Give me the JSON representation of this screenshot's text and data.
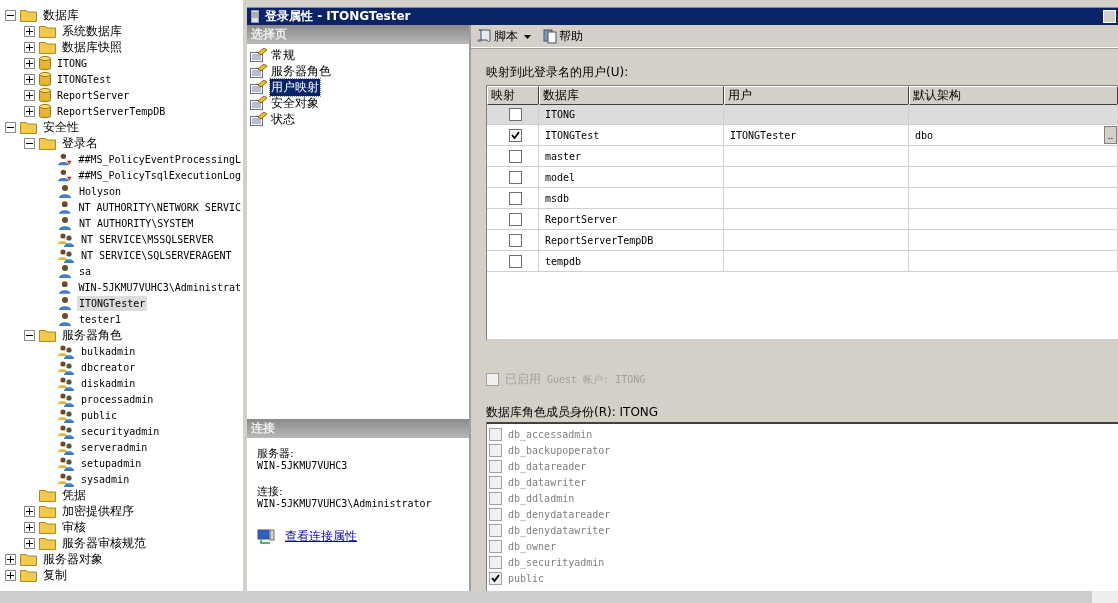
{
  "tree": [
    {
      "label": "数据库",
      "kind": "folder",
      "expanded": true,
      "selected": false,
      "children": [
        {
          "label": "系统数据库",
          "kind": "folder",
          "expanded": false,
          "selected": false
        },
        {
          "label": "数据库快照",
          "kind": "folder",
          "expanded": false,
          "selected": false
        },
        {
          "label": "ITONG",
          "kind": "database",
          "expanded": false,
          "selected": false
        },
        {
          "label": "ITONGTest",
          "kind": "database",
          "expanded": false,
          "selected": false
        },
        {
          "label": "ReportServer",
          "kind": "database",
          "expanded": false,
          "selected": false
        },
        {
          "label": "ReportServerTempDB",
          "kind": "database",
          "expanded": false,
          "selected": false
        }
      ]
    },
    {
      "label": "安全性",
      "kind": "folder",
      "expanded": true,
      "selected": false,
      "children": [
        {
          "label": "登录名",
          "kind": "folder",
          "expanded": true,
          "selected": false,
          "children": [
            {
              "label": "##MS_PolicyEventProcessingL",
              "kind": "user-disabled",
              "selected": false
            },
            {
              "label": "##MS_PolicyTsqlExecutionLog",
              "kind": "user-disabled",
              "selected": false
            },
            {
              "label": "Holyson",
              "kind": "user",
              "selected": false
            },
            {
              "label": "NT AUTHORITY\\NETWORK SERVIC",
              "kind": "user",
              "selected": false
            },
            {
              "label": "NT AUTHORITY\\SYSTEM",
              "kind": "user",
              "selected": false
            },
            {
              "label": "NT SERVICE\\MSSQLSERVER",
              "kind": "group",
              "selected": false
            },
            {
              "label": "NT SERVICE\\SQLSERVERAGENT",
              "kind": "group",
              "selected": false
            },
            {
              "label": "sa",
              "kind": "user",
              "selected": false
            },
            {
              "label": "WIN-5JKMU7VUHC3\\Administrat",
              "kind": "user",
              "selected": false
            },
            {
              "label": "ITONGTester",
              "kind": "user",
              "selected": true
            },
            {
              "label": "tester1",
              "kind": "user",
              "selected": false
            }
          ]
        },
        {
          "label": "服务器角色",
          "kind": "folder",
          "expanded": true,
          "selected": false,
          "children": [
            {
              "label": "bulkadmin",
              "kind": "group",
              "selected": false
            },
            {
              "label": "dbcreator",
              "kind": "group",
              "selected": false
            },
            {
              "label": "diskadmin",
              "kind": "group",
              "selected": false
            },
            {
              "label": "processadmin",
              "kind": "group",
              "selected": false
            },
            {
              "label": "public",
              "kind": "group",
              "selected": false
            },
            {
              "label": "securityadmin",
              "kind": "group",
              "selected": false
            },
            {
              "label": "serveradmin",
              "kind": "group",
              "selected": false
            },
            {
              "label": "setupadmin",
              "kind": "group",
              "selected": false
            },
            {
              "label": "sysadmin",
              "kind": "group",
              "selected": false
            }
          ]
        },
        {
          "label": "凭据",
          "kind": "folder",
          "selected": false
        },
        {
          "label": "加密提供程序",
          "kind": "folder",
          "expanded": false,
          "selected": false
        },
        {
          "label": "审核",
          "kind": "folder",
          "expanded": false,
          "selected": false
        },
        {
          "label": "服务器审核规范",
          "kind": "folder",
          "expanded": false,
          "selected": false
        }
      ]
    },
    {
      "label": "服务器对象",
      "kind": "folder",
      "expanded": false,
      "selected": false
    },
    {
      "label": "复制",
      "kind": "folder",
      "expanded": false,
      "selected": false
    }
  ],
  "window": {
    "title": "登录属性 - ITONGTester"
  },
  "select_page": {
    "header": "选择页",
    "pages": [
      {
        "label": "常规",
        "selected": false
      },
      {
        "label": "服务器角色",
        "selected": false
      },
      {
        "label": "用户映射",
        "selected": true
      },
      {
        "label": "安全对象",
        "selected": false
      },
      {
        "label": "状态",
        "selected": false
      }
    ]
  },
  "connection": {
    "header": "连接",
    "server_label": "服务器:",
    "server": "WIN-5JKMU7VUHC3",
    "connection_label": "连接:",
    "connection": "WIN-5JKMU7VUHC3\\Administrator",
    "link": "查看连接属性"
  },
  "toolbar": {
    "script": "脚本",
    "help": "帮助"
  },
  "mapping": {
    "label": "映射到此登录名的用户(U):",
    "columns": [
      "映射",
      "数据库",
      "用户",
      "默认架构"
    ],
    "rows": [
      {
        "mapped": false,
        "database": "ITONG",
        "selected": true
      },
      {
        "mapped": true,
        "database": "ITONGTest",
        "user": "ITONGTester",
        "schema": "dbo",
        "schema_button": "..",
        "selected": false
      },
      {
        "mapped": false,
        "database": "master",
        "selected": false
      },
      {
        "mapped": false,
        "database": "model",
        "selected": false
      },
      {
        "mapped": false,
        "database": "msdb",
        "selected": false
      },
      {
        "mapped": false,
        "database": "ReportServer",
        "selected": false
      },
      {
        "mapped": false,
        "database": "ReportServerTempDB",
        "selected": false
      },
      {
        "mapped": false,
        "database": "tempdb",
        "selected": false
      }
    ]
  },
  "guest": {
    "label": "已启用",
    "account": "Guest 帐户: ITONG",
    "checked": false,
    "disabled": true
  },
  "roles": {
    "label": "数据库角色成员身份(R): ITONG",
    "disabled": true,
    "items": [
      {
        "label": "db_accessadmin",
        "checked": false
      },
      {
        "label": "db_backupoperator",
        "checked": false
      },
      {
        "label": "db_datareader",
        "checked": false
      },
      {
        "label": "db_datawriter",
        "checked": false
      },
      {
        "label": "db_ddladmin",
        "checked": false
      },
      {
        "label": "db_denydatareader",
        "checked": false
      },
      {
        "label": "db_denydatawriter",
        "checked": false
      },
      {
        "label": "db_owner",
        "checked": false
      },
      {
        "label": "db_securityadmin",
        "checked": false
      },
      {
        "label": "public",
        "checked": true
      }
    ]
  }
}
